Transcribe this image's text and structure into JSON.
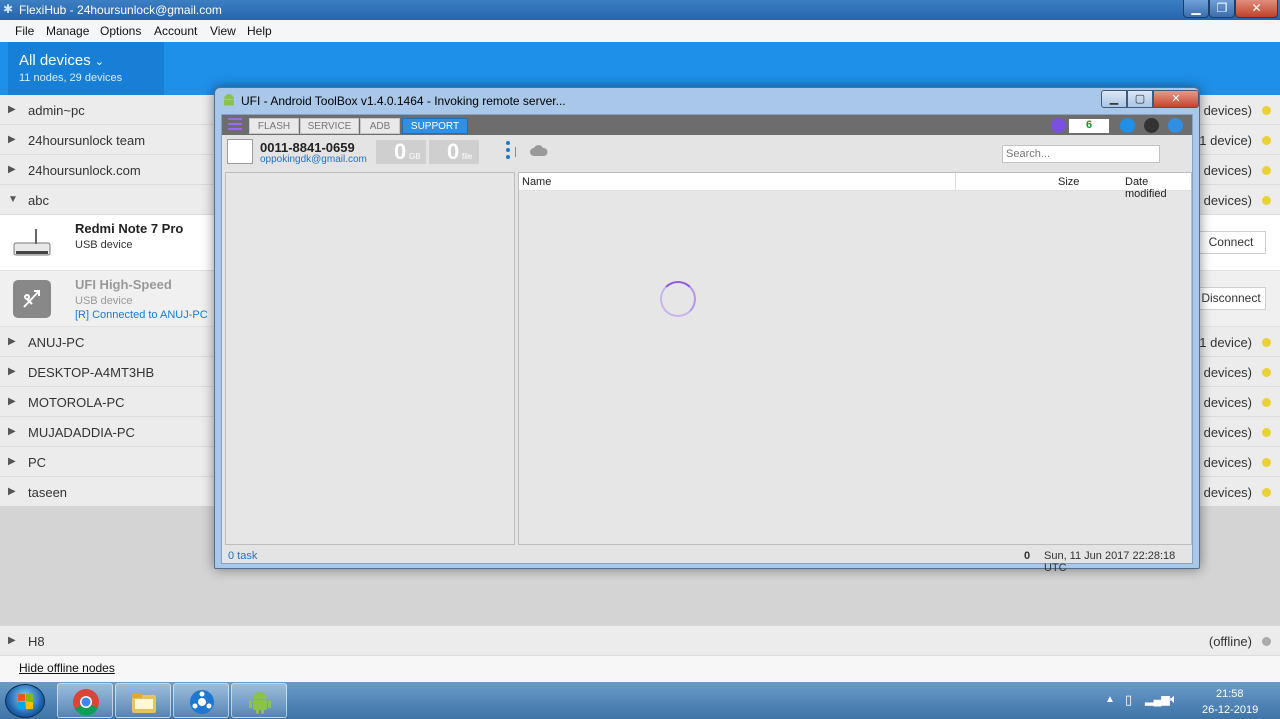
{
  "flexihub": {
    "title": "FlexiHub - 24hoursunlock@gmail.com",
    "menu": [
      "File",
      "Manage",
      "Options",
      "Account",
      "View",
      "Help"
    ],
    "header": {
      "title": "All devices",
      "subtitle": "11 nodes, 29 devices"
    },
    "nodes": [
      {
        "name": "admin~pc",
        "count": "devices)",
        "expanded": false
      },
      {
        "name": "24hoursunlock team",
        "count": "(1 device)",
        "expanded": false
      },
      {
        "name": "24hoursunlock.com",
        "count": "5 devices)",
        "expanded": false
      },
      {
        "name": "abc",
        "count": "2 devices)",
        "expanded": true
      },
      {
        "name": "ANUJ-PC",
        "count": "(1 device)",
        "expanded": false
      },
      {
        "name": "DESKTOP-A4MT3HB",
        "count": "4 devices)",
        "expanded": false
      },
      {
        "name": "MOTOROLA-PC",
        "count": "6 devices)",
        "expanded": false
      },
      {
        "name": "MUJADADDIA-PC",
        "count": "2 devices)",
        "expanded": false
      },
      {
        "name": "PC",
        "count": "5 devices)",
        "expanded": false
      },
      {
        "name": "taseen",
        "count": "3 devices)",
        "expanded": false
      }
    ],
    "devices": [
      {
        "title": "Redmi Note 7 Pro",
        "type": "USB device",
        "status": "",
        "button": "Connect"
      },
      {
        "title": "UFI High-Speed",
        "type": "USB device",
        "status": "[R] Connected to ANUJ-PC",
        "button": "Disconnect"
      }
    ],
    "offline_node": {
      "name": "H8",
      "count": "(offline)"
    },
    "hide_offline": "Hide offline nodes",
    "colors": {
      "header": "#1e90ea",
      "online_dot": "#e9d234",
      "offline_dot": "#aaaaaa"
    }
  },
  "ufi": {
    "title": "UFI - Android ToolBox v1.4.0.1464  - Invoking remote server...",
    "tabs": [
      "FLASH",
      "SERVICE",
      "ADB",
      "SUPPORT"
    ],
    "active_tab": "SUPPORT",
    "credits": "6",
    "account": "0011-8841-0659",
    "email": "oppokingdk@gmail.com",
    "counter_gb": {
      "value": "0",
      "unit": "GB"
    },
    "counter_file": {
      "value": "0",
      "unit": "file"
    },
    "search_placeholder": "Search...",
    "columns": {
      "name": "Name",
      "size": "Size",
      "date": "Date modified"
    },
    "task": "0 task",
    "status_count": "0",
    "status_datetime": "Sun, 11 Jun 2017 22:28:18 UTC"
  },
  "taskbar": {
    "apps": [
      "chrome-icon",
      "explorer-icon",
      "flexihub-icon",
      "android-icon"
    ],
    "time": "21:58",
    "date": "26-12-2019"
  }
}
